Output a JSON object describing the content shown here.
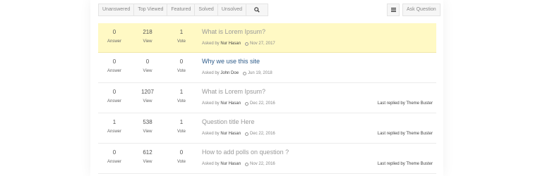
{
  "toolbar": {
    "filters": [
      "Unanswered",
      "Top Viewed",
      "Featured",
      "Solved",
      "Unsolved"
    ],
    "search_icon": "search-icon",
    "menu_icon": "hamburger-menu-icon",
    "ask_label": "Ask Question"
  },
  "colors": {
    "highlight": "#fff9c4",
    "link": "#2e5c8a"
  },
  "questions": [
    {
      "answers": "0",
      "answer_label": "Answer",
      "views": "218",
      "view_label": "View",
      "votes": "1",
      "vote_label": "Vote",
      "title": "What is Lorem Ipsum?",
      "asked_by": "Asked by",
      "author": "Nur Hasan",
      "date": "Nov 27, 2017",
      "last_replied": ""
    },
    {
      "answers": "0",
      "answer_label": "Answer",
      "views": "0",
      "view_label": "View",
      "votes": "0",
      "vote_label": "Vote",
      "title": "Why we use this site",
      "asked_by": "Asked by",
      "author": "John Doe",
      "date": "Jun 19, 2018",
      "last_replied": ""
    },
    {
      "answers": "0",
      "answer_label": "Answer",
      "views": "1207",
      "view_label": "View",
      "votes": "1",
      "vote_label": "Vote",
      "title": "What is Lorem Ipsum?",
      "asked_by": "Asked by",
      "author": "Nur Hasan",
      "date": "Dec 22, 2016",
      "last_replied": "Last replied by Theme Buster"
    },
    {
      "answers": "1",
      "answer_label": "Answer",
      "views": "538",
      "view_label": "View",
      "votes": "1",
      "vote_label": "Vote",
      "title": "Question title Here",
      "asked_by": "Asked by",
      "author": "Nur Hasan",
      "date": "Dec 22, 2016",
      "last_replied": "Last replied by Theme Buster"
    },
    {
      "answers": "0",
      "answer_label": "Answer",
      "views": "612",
      "view_label": "View",
      "votes": "0",
      "vote_label": "Vote",
      "title": "How to add polls on question ?",
      "asked_by": "Asked by",
      "author": "Nur Hasan",
      "date": "Nov 22, 2016",
      "last_replied": "Last replied by Theme Buster"
    }
  ]
}
